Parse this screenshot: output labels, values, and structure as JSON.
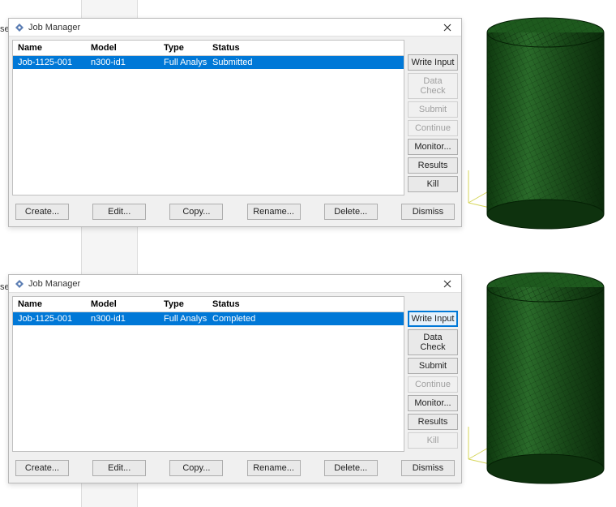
{
  "left_labels": [
    "se",
    "se"
  ],
  "window_title": "Job Manager",
  "columns": {
    "name": "Name",
    "model": "Model",
    "type": "Type",
    "status": "Status"
  },
  "dialogs": [
    {
      "row": {
        "name": "Job-1125-001",
        "model": "n300-id1",
        "type": "Full Analysis",
        "status": "Submitted"
      },
      "side_buttons": [
        {
          "label": "Write Input",
          "state": "enabled"
        },
        {
          "label": "Data Check",
          "state": "disabled"
        },
        {
          "label": "Submit",
          "state": "disabled"
        },
        {
          "label": "Continue",
          "state": "disabled"
        },
        {
          "label": "Monitor...",
          "state": "enabled"
        },
        {
          "label": "Results",
          "state": "enabled"
        },
        {
          "label": "Kill",
          "state": "enabled"
        }
      ]
    },
    {
      "row": {
        "name": "Job-1125-001",
        "model": "n300-id1",
        "type": "Full Analysis",
        "status": "Completed"
      },
      "side_buttons": [
        {
          "label": "Write Input",
          "state": "highlighted"
        },
        {
          "label": "Data Check",
          "state": "enabled"
        },
        {
          "label": "Submit",
          "state": "enabled"
        },
        {
          "label": "Continue",
          "state": "disabled"
        },
        {
          "label": "Monitor...",
          "state": "enabled"
        },
        {
          "label": "Results",
          "state": "enabled"
        },
        {
          "label": "Kill",
          "state": "disabled"
        }
      ]
    }
  ],
  "bottom_buttons": {
    "create": "Create...",
    "edit": "Edit...",
    "copy": "Copy...",
    "rename": "Rename...",
    "delete": "Delete...",
    "dismiss": "Dismiss"
  }
}
